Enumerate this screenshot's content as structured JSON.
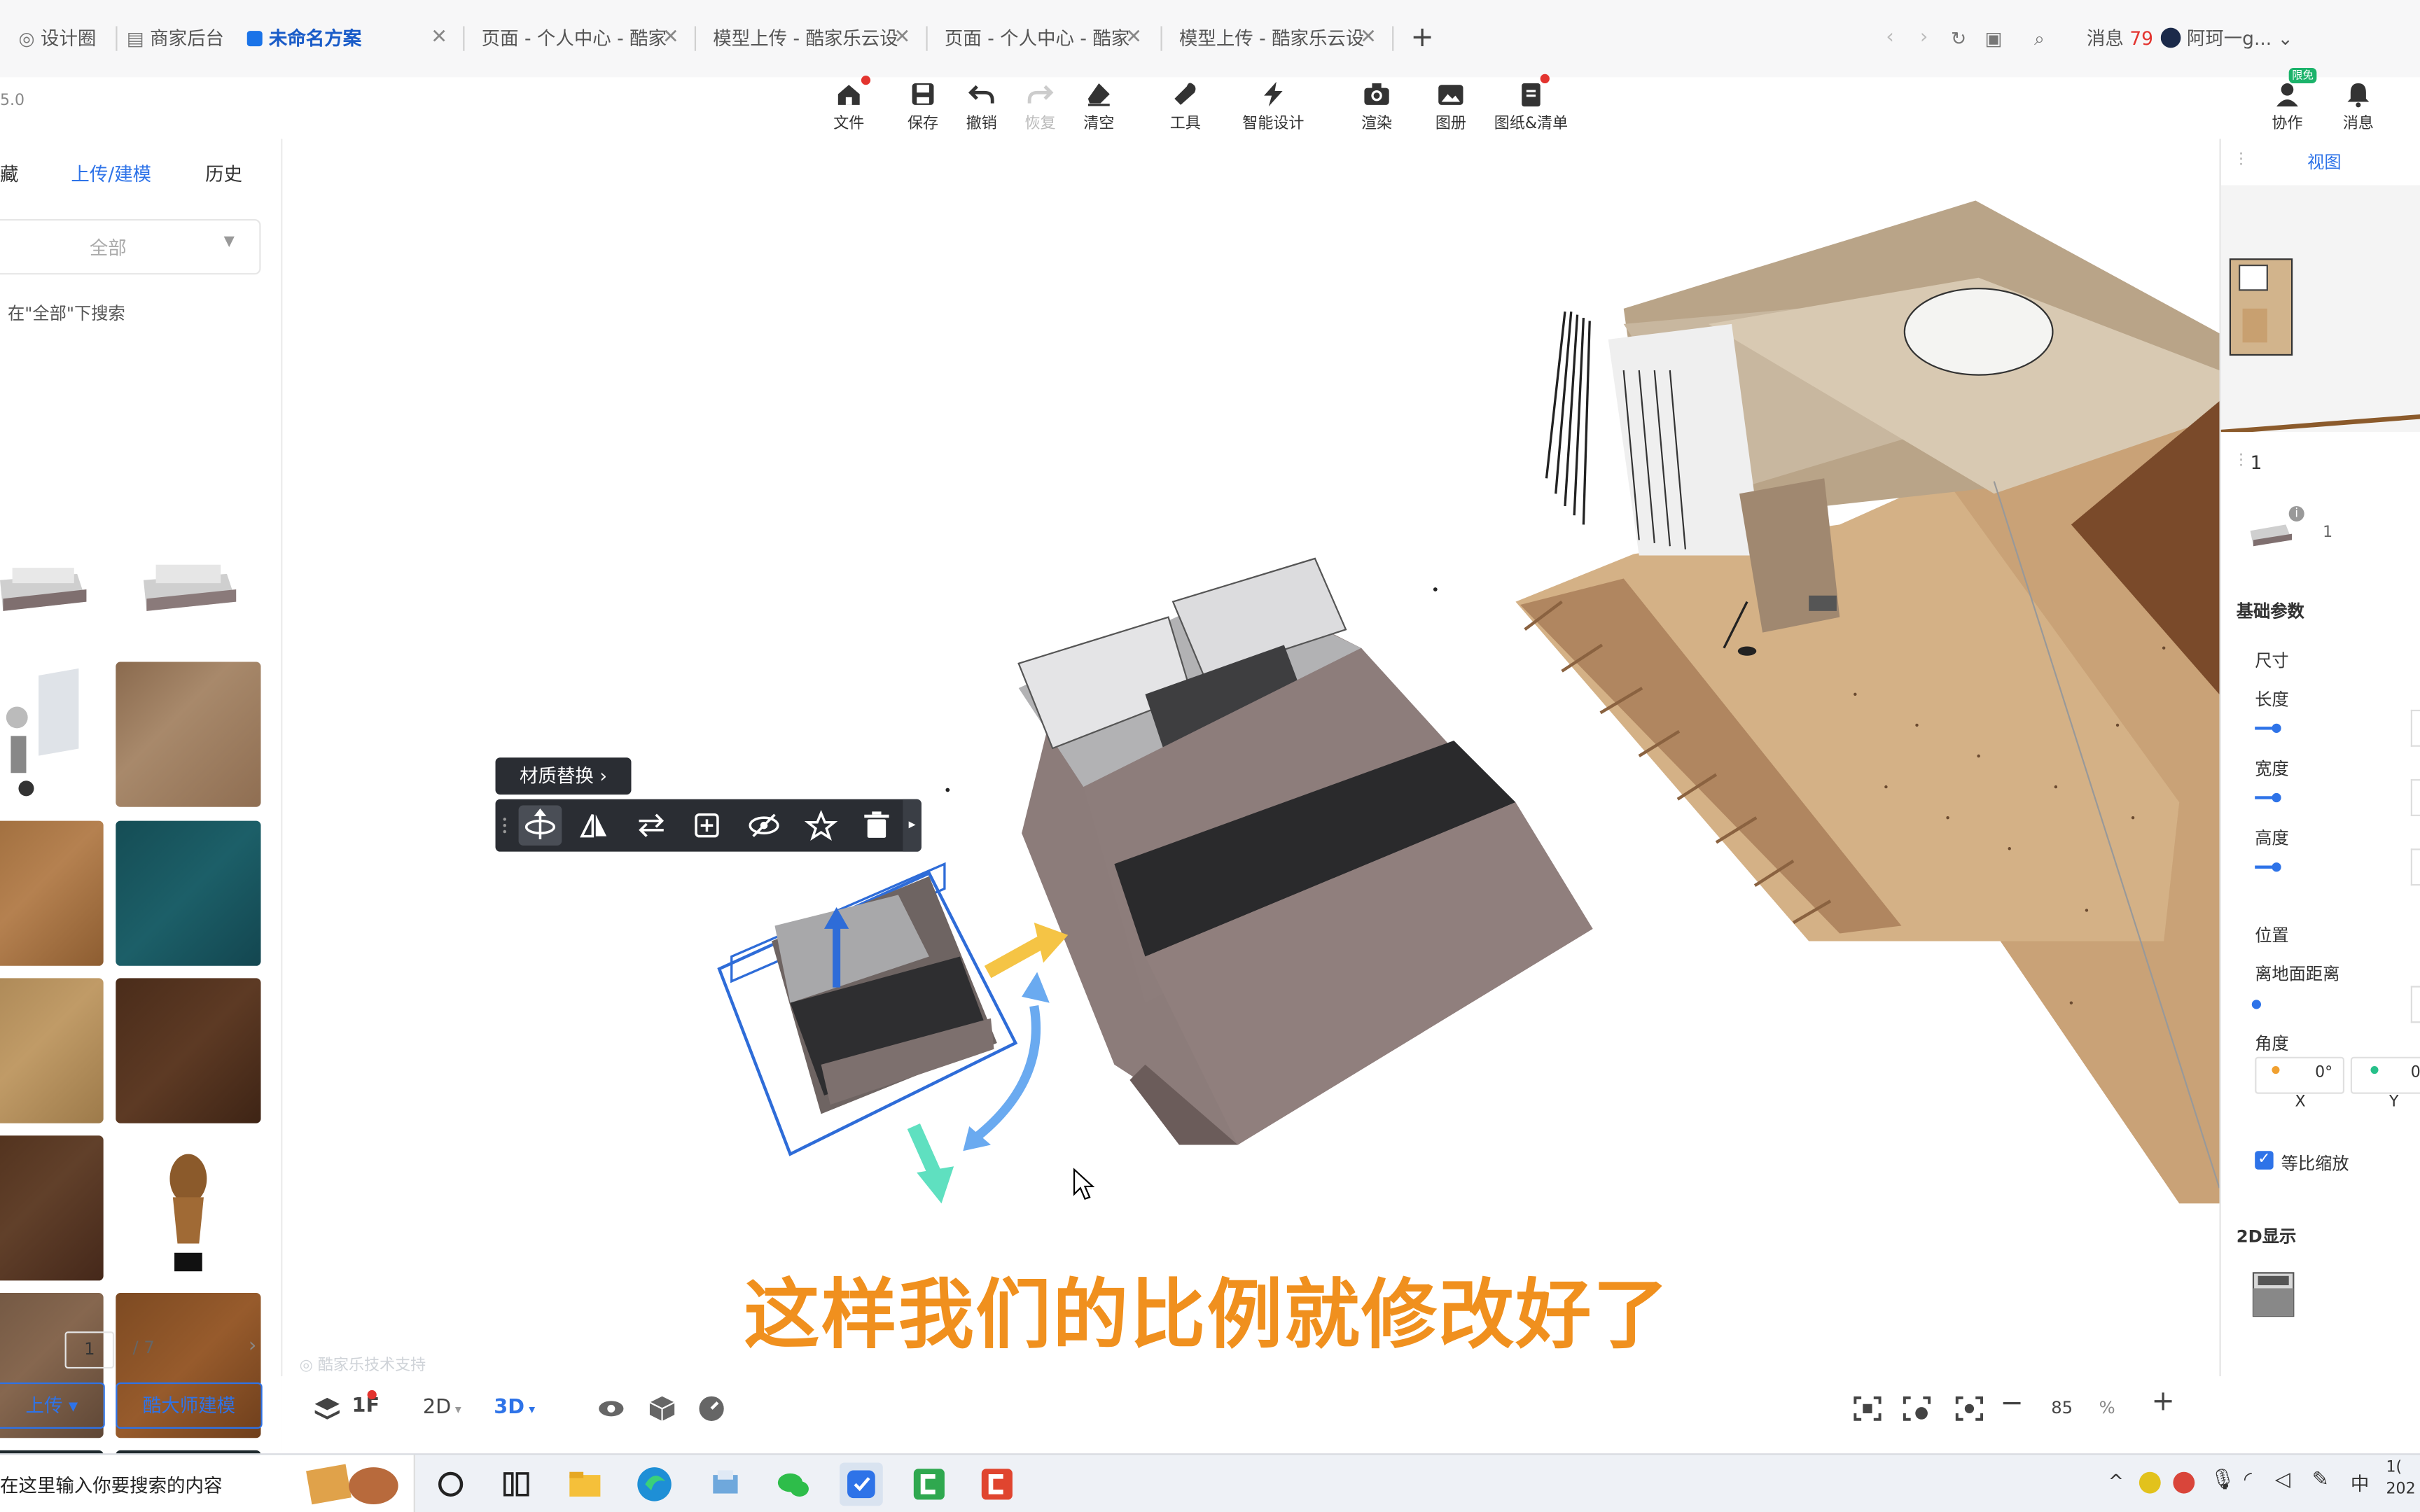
{
  "browser": {
    "tabs": [
      {
        "label": "设计圈",
        "active": false
      },
      {
        "label": "商家后台",
        "active": false
      },
      {
        "label": "未命名方案",
        "active": true
      },
      {
        "label": "页面 - 个人中心 - 酷家",
        "active": false
      },
      {
        "label": "模型上传 - 酷家乐云设",
        "active": false
      },
      {
        "label": "页面 - 个人中心 - 酷家",
        "active": false
      },
      {
        "label": "模型上传 - 酷家乐云设",
        "active": false
      }
    ],
    "new_tab": "+",
    "messages_label": "消息",
    "messages_count": "79",
    "user_name": "阿珂一g..."
  },
  "toolbar": {
    "version": "5.0",
    "items": [
      {
        "label": "文件",
        "icon": "home-icon"
      },
      {
        "label": "保存",
        "icon": "save-icon"
      },
      {
        "label": "撤销",
        "icon": "undo-icon"
      },
      {
        "label": "恢复",
        "icon": "redo-icon"
      },
      {
        "label": "清空",
        "icon": "eraser-icon"
      },
      {
        "label": "工具",
        "icon": "wrench-icon"
      },
      {
        "label": "智能设计",
        "icon": "lightning-icon"
      },
      {
        "label": "渲染",
        "icon": "camera-icon"
      },
      {
        "label": "图册",
        "icon": "gallery-icon"
      },
      {
        "label": "图纸&清单",
        "icon": "document-icon"
      }
    ],
    "collab_label": "协作",
    "collab_badge": "限免",
    "notify_label": "消息"
  },
  "left_panel": {
    "tabs": [
      "藏",
      "上传/建模",
      "历史"
    ],
    "active_tab": "上传/建模",
    "filter_value": "全部",
    "search_hint": "在\"全部\"下搜索",
    "page_current": "1",
    "page_total": "/ 7",
    "upload_button": "上传 ▾",
    "master_button": "酷大师建模"
  },
  "floating_toolbar": {
    "material_label": "材质替换",
    "tools": [
      "move-icon",
      "mirror-icon",
      "replace-icon",
      "copy-icon",
      "hide-icon",
      "star-icon",
      "delete-icon"
    ]
  },
  "right_panel": {
    "view_label": "视图",
    "selection_count": "1",
    "item_count": "1",
    "basic_params": "基础参数",
    "size_label": "尺寸",
    "length_label": "长度",
    "width_label": "宽度",
    "height_label": "高度",
    "position_label": "位置",
    "ground_offset_label": "离地面距离",
    "angle_label": "角度",
    "angle_x_value": "0°",
    "angle_y_value": "0",
    "axis_x": "X",
    "axis_y": "Y",
    "proportional_label": "等比缩放",
    "display_2d_label": "2D显示"
  },
  "bottom_bar": {
    "floor_label": "1F",
    "mode_2d": "2D",
    "mode_3d": "3D",
    "zoom_value": "85",
    "zoom_unit": "%",
    "watermark": "酷家乐技术支持"
  },
  "caption": "这样我们的比例就修改好了",
  "taskbar": {
    "search_placeholder": "在这里输入你要搜索的内容",
    "ime": "中",
    "clock_top": "1(",
    "clock_bottom": "202"
  },
  "colors": {
    "accent": "#2e73e8",
    "caption": "#f0901e",
    "floating_toolbar": "#2a2d33"
  }
}
